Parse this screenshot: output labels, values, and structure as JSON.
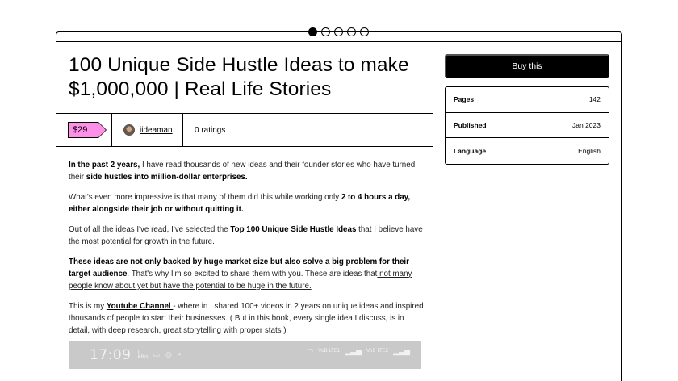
{
  "carousel": {
    "dot_count": 5,
    "active_index": 0
  },
  "product": {
    "title": "100 Unique Side Hustle Ideas to make $1,000,000 | Real Life Stories",
    "price": "$29",
    "author": "iideaman",
    "ratings": "0 ratings"
  },
  "description": {
    "p1_bold": "In the past 2 years,",
    "p1_text": " I have read thousands of new ideas and their founder stories who have turned their ",
    "p1_bold2": "side hustles into million-dollar enterprises.",
    "p2_text": "What's even more impressive is that many of them did this while working only ",
    "p2_bold": "2 to 4 hours a day, either alongside their job or without quitting it.",
    "p3_text": "Out of all the ideas I've read, I've selected the ",
    "p3_bold": "Top 100 Unique Side Hustle Ideas",
    "p3_text2": " that I believe have the most potential for growth in the future.",
    "p4_bold": "These ideas are not only backed by huge market size but also solve a big problem for their target audience",
    "p4_text": ". That's why I'm so excited to share them with you. These are ideas that",
    "p4_link": " not many people know about yet but have the potential to be huge in the future.",
    "p5_text": "This is my ",
    "p5_link": "Youtube Channel ",
    "p5_text2": "- where in I shared 100+ videos in 2 years on unique ideas and inspired thousands of people to start their businesses. ( But in this book, every single idea I discuss, is in detail, with deep research, great storytelling with proper stats )"
  },
  "preview_image": {
    "time": "17:09",
    "net_speed": "0 KB/s",
    "carrier1": "VoB LTE1",
    "carrier2": "VoB LTE2"
  },
  "sidebar": {
    "buy_label": "Buy this",
    "info": [
      {
        "key": "Pages",
        "value": "142"
      },
      {
        "key": "Published",
        "value": "Jan 2023"
      },
      {
        "key": "Language",
        "value": "English"
      }
    ]
  },
  "colors": {
    "price_tag": "#ff90e8",
    "button_bg": "#000000"
  }
}
